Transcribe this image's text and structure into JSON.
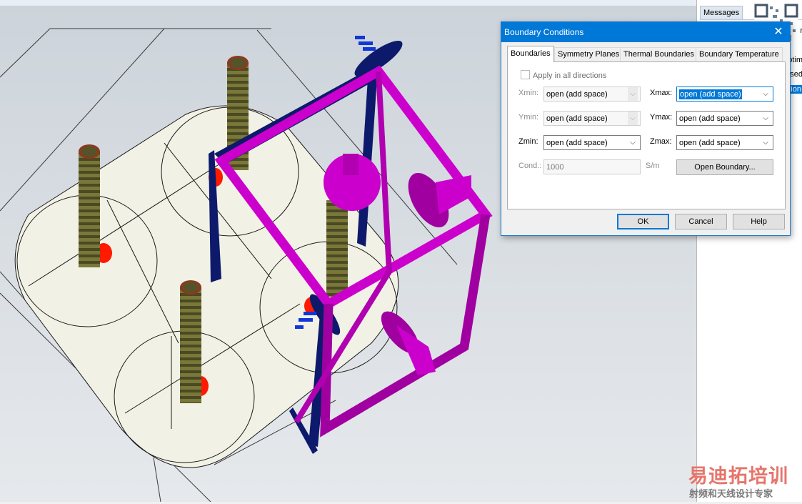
{
  "right_panel": {
    "tab": "Messages",
    "fragments": [
      "ld r",
      "ptim",
      "sed",
      "tion"
    ]
  },
  "dialog": {
    "title": "Boundary Conditions",
    "tabs": [
      "Boundaries",
      "Symmetry Planes",
      "Thermal Boundaries",
      "Boundary Temperature"
    ],
    "apply_all_label": "Apply in all directions",
    "xmin_label": "Xmin:",
    "xmin_value": "open (add space)",
    "xmax_label": "Xmax:",
    "xmax_value": "open (add space)",
    "ymin_label": "Ymin:",
    "ymin_value": "open (add space)",
    "ymax_label": "Ymax:",
    "ymax_value": "open (add space)",
    "zmin_label": "Zmin:",
    "zmin_value": "open (add space)",
    "zmax_label": "Zmax:",
    "zmax_value": "open (add space)",
    "cond_label": "Cond.:",
    "cond_value": "1000",
    "cond_unit": "S/m",
    "open_boundary_button": "Open Boundary...",
    "ok_button": "OK",
    "cancel_button": "Cancel",
    "help_button": "Help"
  },
  "watermark": {
    "brand": "易迪拓培训",
    "tagline": "射频和天线设计专家"
  },
  "colors": {
    "accent": "#0078d7",
    "magenta": "#cc00cc",
    "navy": "#0d1a6b",
    "pad": "#f2f1e6",
    "screw": "#55532a",
    "port": "#ff1a00"
  }
}
